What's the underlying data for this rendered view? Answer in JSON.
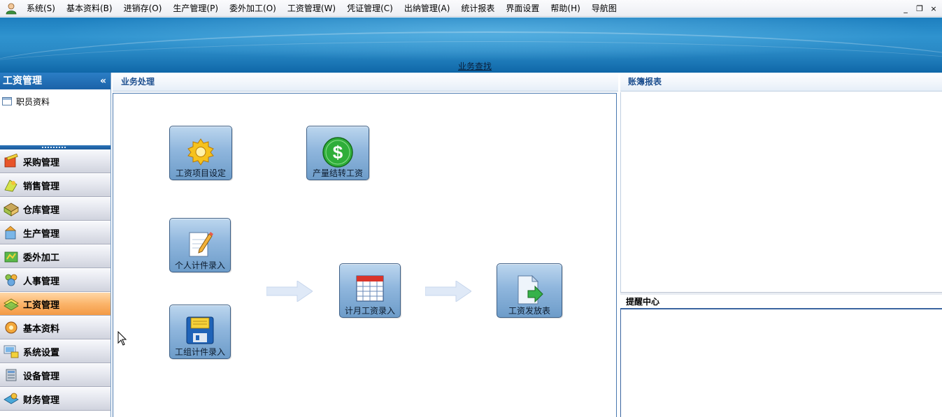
{
  "menubar": {
    "items": [
      {
        "label": "系统(S)"
      },
      {
        "label": "基本资料(B)"
      },
      {
        "label": "进销存(O)"
      },
      {
        "label": "生产管理(P)"
      },
      {
        "label": "委外加工(O)"
      },
      {
        "label": "工资管理(W)"
      },
      {
        "label": "凭证管理(C)"
      },
      {
        "label": "出纳管理(A)"
      },
      {
        "label": "统计报表"
      },
      {
        "label": "界面设置"
      },
      {
        "label": "帮助(H)"
      },
      {
        "label": "导航图"
      }
    ],
    "window_controls": {
      "minimize": "_",
      "restore": "❐",
      "close": "×"
    }
  },
  "banner": {
    "search_link": "业务查找"
  },
  "left_panel": {
    "title": "工资管理",
    "collapse_glyph": "«",
    "tree_items": [
      {
        "label": "职员资料",
        "icon": "table-icon"
      }
    ],
    "nav_items": [
      {
        "label": "采购管理",
        "icon": "purchase-icon"
      },
      {
        "label": "销售管理",
        "icon": "sales-icon"
      },
      {
        "label": "仓库管理",
        "icon": "warehouse-icon"
      },
      {
        "label": "生产管理",
        "icon": "production-icon"
      },
      {
        "label": "委外加工",
        "icon": "outsource-icon"
      },
      {
        "label": "人事管理",
        "icon": "people-icon"
      },
      {
        "label": "工资管理",
        "icon": "payroll-icon",
        "active": true
      },
      {
        "label": "基本资料",
        "icon": "basic-data-icon"
      },
      {
        "label": "系统设置",
        "icon": "system-settings-icon"
      },
      {
        "label": "设备管理",
        "icon": "equipment-icon"
      },
      {
        "label": "财务管理",
        "icon": "finance-icon"
      }
    ]
  },
  "center_panel": {
    "title": "业务处理",
    "tiles": {
      "salary_item_setup": "工资项目设定",
      "output_transfer_salary": "产量结转工资",
      "individual_piece_entry": "个人计件录入",
      "monthly_salary_entry": "计月工资录入",
      "salary_payment_sheet": "工资发放表",
      "group_piece_entry": "工组计件录入"
    }
  },
  "right_panel": {
    "ledger_title": "账簿报表",
    "reminder_title": "提醒中心"
  },
  "colors": {
    "accent": "#1b62a8",
    "active_nav": "#f7a552",
    "tile": "#8fb6dd"
  }
}
